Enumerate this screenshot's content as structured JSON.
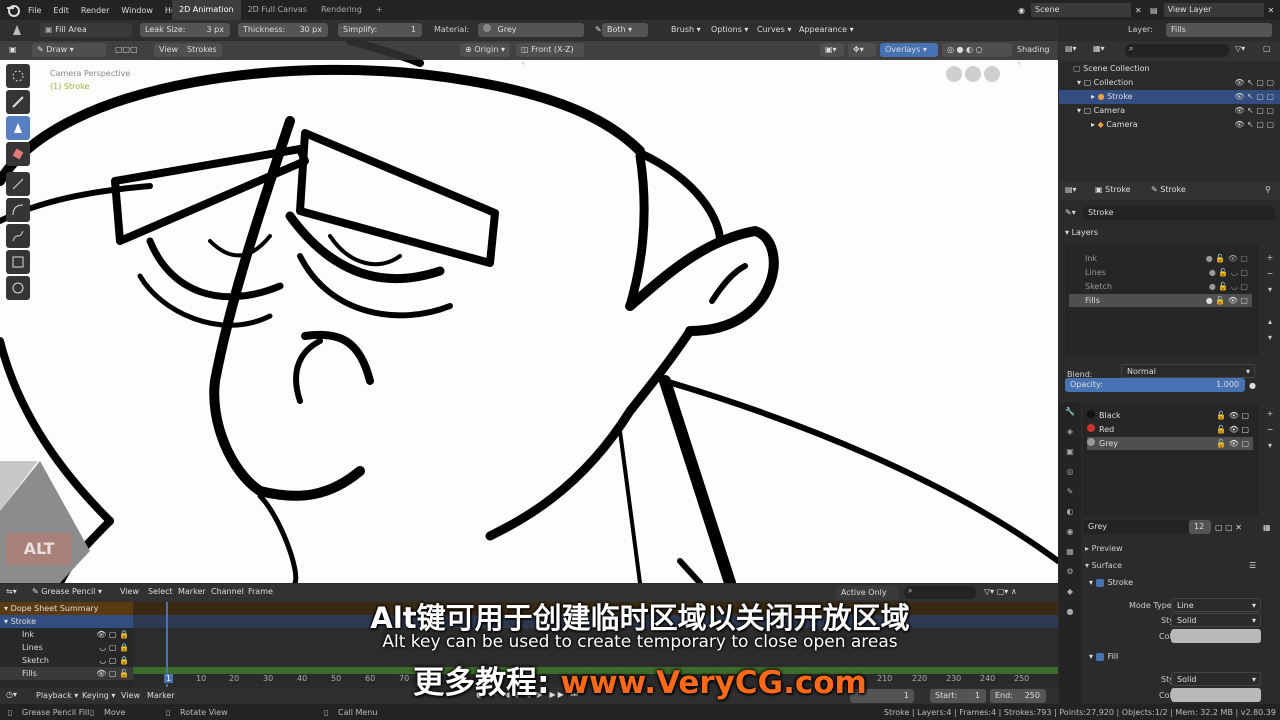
{
  "top_menu": [
    "File",
    "Edit",
    "Render",
    "Window",
    "Help"
  ],
  "workspaces": [
    "2D Animation",
    "2D Full Canvas",
    "Rendering"
  ],
  "scene_label": "Scene",
  "view_layer_label": "View Layer",
  "tool_header": {
    "mode": "Fill Area",
    "leak_size_label": "Leak Size:",
    "leak_size_value": "3 px",
    "thickness_label": "Thickness:",
    "thickness_value": "30 px",
    "simplify_label": "Simplify:",
    "simplify_value": "1",
    "material_label": "Material:",
    "material_value": "Grey",
    "both_label": "Both",
    "brush_label": "Brush",
    "options_label": "Options",
    "curves_label": "Curves",
    "appearance_label": "Appearance",
    "layer_label": "Layer:",
    "layer_value": "Fills"
  },
  "viewport_header": {
    "mode": "Draw",
    "view_btn": "View",
    "strokes_btn": "Strokes",
    "origin": "Origin",
    "view_axis": "Front (X-Z)",
    "overlays": "Overlays",
    "shading": "Shading"
  },
  "viewport": {
    "camera_label": "Camera Perspective",
    "object_label": "(1) Stroke",
    "alt_badge": "ALT"
  },
  "outliner": {
    "items": [
      {
        "label": "Scene Collection"
      },
      {
        "label": "Collection"
      },
      {
        "label": "Stroke"
      },
      {
        "label": "Camera"
      },
      {
        "label": "Camera"
      }
    ]
  },
  "properties": {
    "tab_object": "Stroke",
    "tab_data": "Stroke",
    "datablock": "Stroke",
    "layers_header": "Layers",
    "layers": [
      "Ink",
      "Lines",
      "Sketch",
      "Fills"
    ],
    "blend_label": "Blend:",
    "blend_value": "Normal",
    "opacity_label": "Opacity:",
    "opacity_value": "1.000",
    "materials": [
      "Black",
      "Red",
      "Grey"
    ],
    "material_name": "Grey",
    "material_users": "12",
    "preview_label": "Preview",
    "surface_label": "Surface",
    "stroke_label": "Stroke",
    "mode_type_label": "Mode Type",
    "mode_type_value": "Line",
    "style_label": "Style",
    "style_value": "Solid",
    "color_label": "Color",
    "fill_label": "Fill",
    "fill_style_label": "Style",
    "fill_style_value": "Solid",
    "fill_color_label": "Color"
  },
  "dopesheet": {
    "mode": "Grease Pencil",
    "menus": [
      "View",
      "Select",
      "Marker",
      "Channel",
      "Frame"
    ],
    "active_only": "Active Only",
    "channels": [
      "Dope Sheet Summary",
      "Stroke",
      "Ink",
      "Lines",
      "Sketch",
      "Fills"
    ],
    "ruler": [
      "1",
      "10",
      "20",
      "30",
      "40",
      "50",
      "60",
      "70",
      "210",
      "220",
      "230",
      "240",
      "250"
    ]
  },
  "playback": {
    "playback_label": "Playback",
    "keying_label": "Keying",
    "view_label": "View",
    "marker_label": "Marker",
    "current_frame": "1",
    "start_label": "Start:",
    "start_value": "1",
    "end_label": "End:",
    "end_value": "250"
  },
  "status": {
    "left1": "Grease Pencil Fill",
    "left2": "Move",
    "left3": "Rotate View",
    "left4": "Call Menu",
    "right": "Stroke | Layers:4 | Frames:4 | Strokes:793 | Points:27,920 | Objects:1/2 | Mem: 32.2 MB | v2.80.39"
  },
  "subtitles": {
    "cn": "Alt键可用于创建临时区域以关闭开放区域",
    "en": "Alt key can be used to create temporary to close open areas",
    "promo_prefix": "更多教程: ",
    "promo_url": "www.VeryCG.com"
  },
  "colors": {
    "accent": "#4772b3",
    "selected_row": "#334d80",
    "subtitle_url": "#ff6a1a",
    "canvas": "#fdfdfb"
  }
}
